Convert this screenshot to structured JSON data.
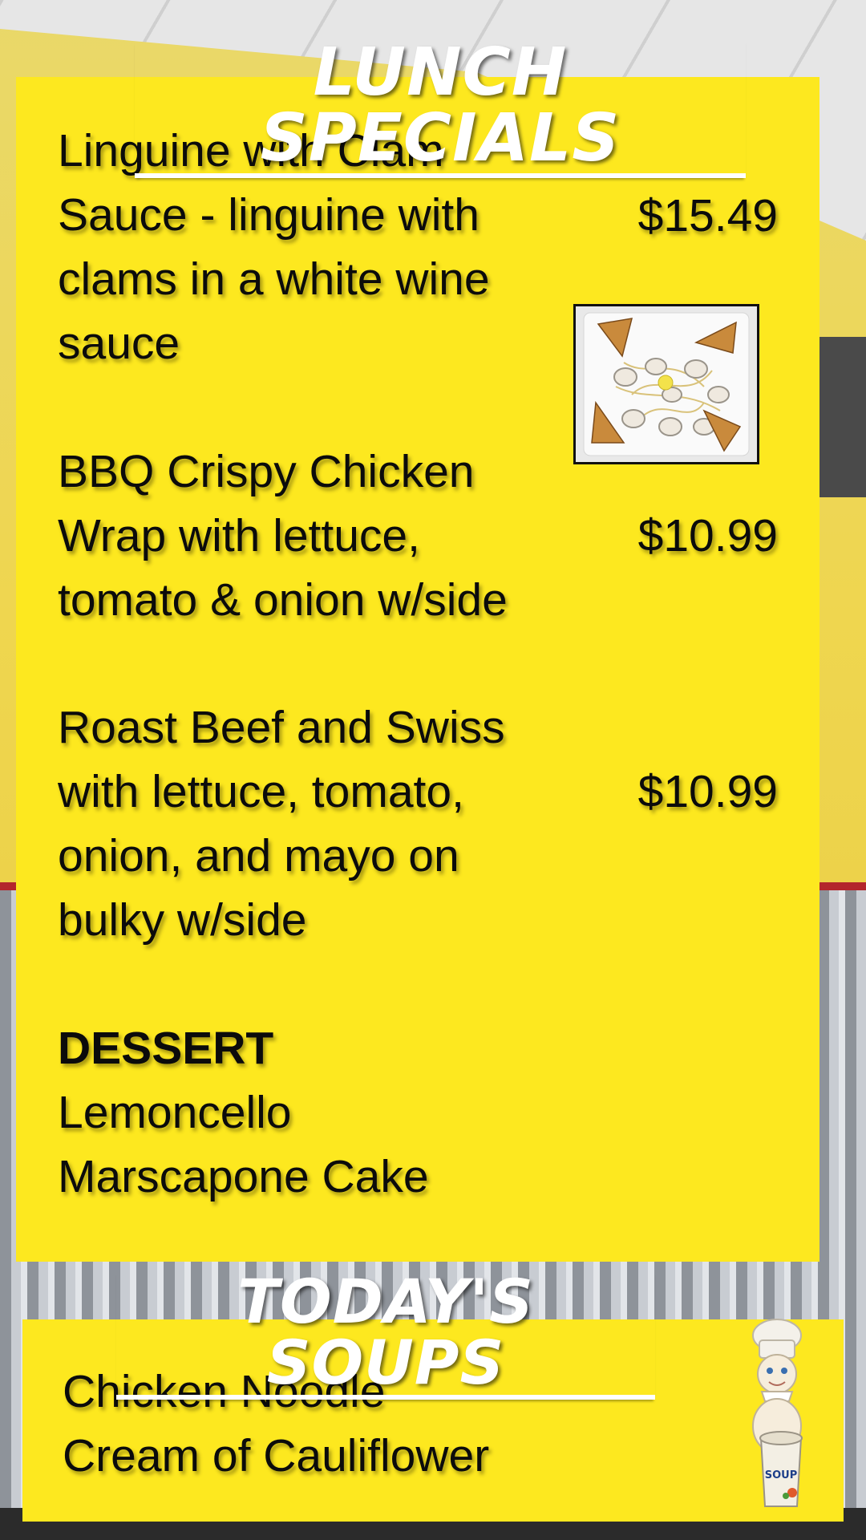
{
  "lunch": {
    "heading": "LUNCH SPECIALS",
    "items": [
      {
        "lines": [
          "Linguine with Clam",
          "Sauce - linguine with",
          "clams in a white wine",
          "sauce"
        ],
        "price": "$15.49"
      },
      {
        "lines": [
          "BBQ Crispy Chicken",
          "Wrap with lettuce,",
          "tomato & onion w/side"
        ],
        "price": "$10.99"
      },
      {
        "lines": [
          "Roast Beef and Swiss",
          "with lettuce, tomato,",
          "onion, and mayo on",
          "bulky w/side"
        ],
        "price": "$10.99"
      }
    ],
    "dessert": {
      "title": "DESSERT",
      "lines": [
        "Lemoncello",
        "Marscapone Cake"
      ]
    }
  },
  "soups": {
    "heading": "TODAY'S SOUPS",
    "items": [
      "Chicken Noodle",
      "Cream of Cauliflower"
    ]
  },
  "mascot": {
    "cup_text": "SOUP"
  },
  "icons": {
    "dish_photo": "clam-linguine-photo-icon",
    "mascot": "chef-doughboy-icon"
  },
  "colors": {
    "panel": "#fde81f",
    "heading": "#ffffff",
    "text": "#0b0b0b"
  }
}
